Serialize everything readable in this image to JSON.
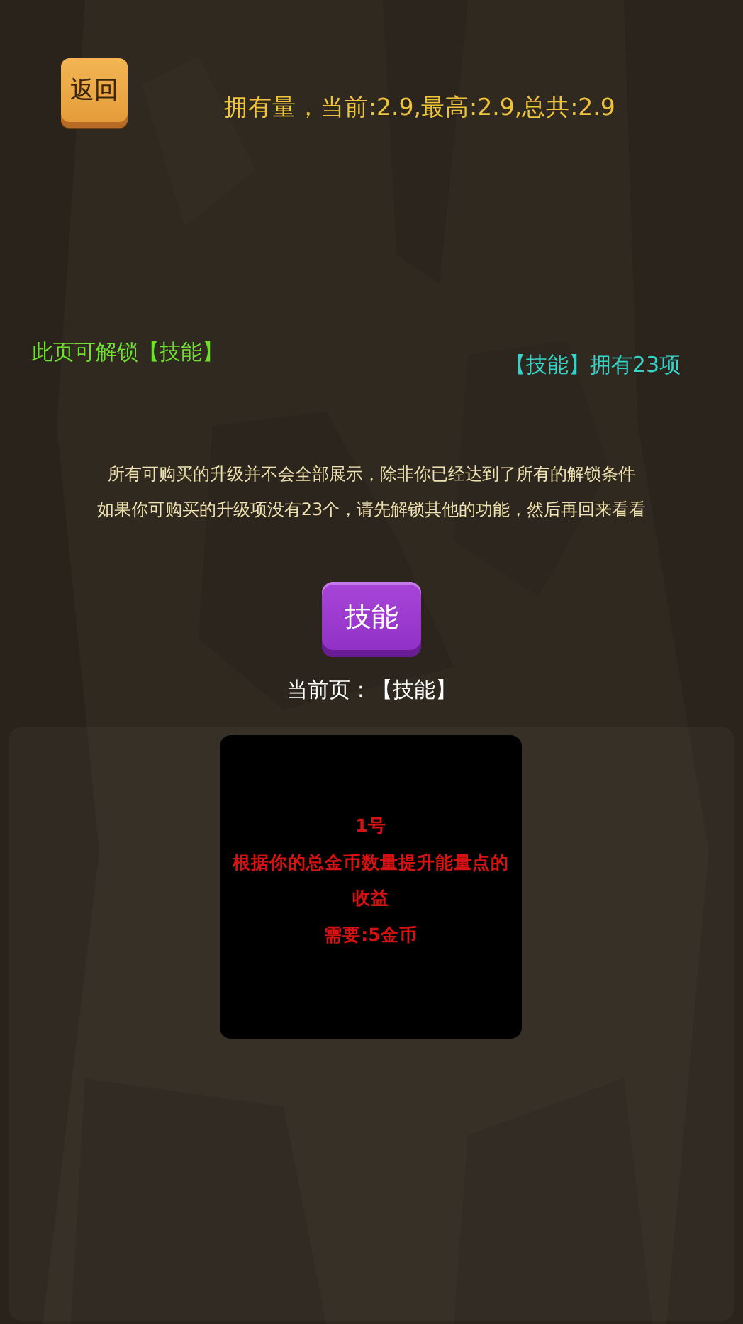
{
  "back_button": {
    "label": "返回"
  },
  "stats": "拥有量，当前:2.9,最高:2.9,总共:2.9",
  "unlock_note": "此页可解锁【技能】",
  "owned_note": "【技能】拥有23项",
  "notice": [
    "所有可购买的升级并不会全部展示，除非你已经达到了所有的解锁条件",
    "如果你可购买的升级项没有23个，请先解锁其他的功能，然后再回来看看"
  ],
  "tabs": [
    {
      "label": "技能",
      "selected": true
    }
  ],
  "current_page": "当前页：【技能】",
  "upgrades": [
    {
      "number": "1号",
      "description": "根据你的总金币数量提升能量点的收益",
      "cost": "需要:5金币",
      "affordable": false
    }
  ]
}
